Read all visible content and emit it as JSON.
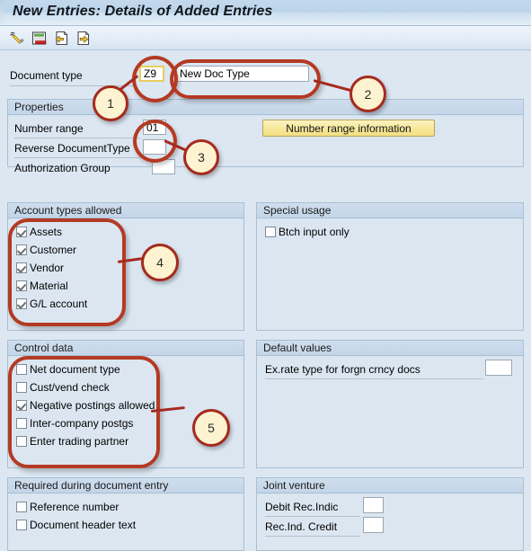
{
  "window": {
    "title": "New Entries: Details of Added Entries"
  },
  "toolbar": {
    "icons": [
      {
        "name": "check-pencil-icon",
        "title": "Check entries"
      },
      {
        "name": "save-note-icon",
        "title": "Save / Note"
      },
      {
        "name": "previous-entry-icon",
        "title": "Previous entry"
      },
      {
        "name": "next-entry-icon",
        "title": "Next entry"
      }
    ]
  },
  "header_form": {
    "document_type_label": "Document type",
    "document_type_key": "Z9",
    "document_type_key_placeholder": "",
    "document_type_text": "New Doc Type",
    "document_type_text_placeholder": ""
  },
  "properties": {
    "title": "Properties",
    "number_range_label": "Number range",
    "number_range_value": "01",
    "reverse_doc_type_label": "Reverse DocumentType",
    "reverse_doc_type_value": "",
    "authorization_group_label": "Authorization Group",
    "authorization_group_value": "",
    "number_range_button": "Number range information"
  },
  "account_types": {
    "title": "Account types allowed",
    "items": [
      {
        "label": "Assets",
        "checked": true
      },
      {
        "label": "Customer",
        "checked": true
      },
      {
        "label": "Vendor",
        "checked": true
      },
      {
        "label": "Material",
        "checked": true
      },
      {
        "label": "G/L account",
        "checked": true
      }
    ]
  },
  "special_usage": {
    "title": "Special usage",
    "items": [
      {
        "label": "Btch input only",
        "checked": false
      }
    ]
  },
  "control_data": {
    "title": "Control data",
    "items": [
      {
        "label": "Net document type",
        "checked": false
      },
      {
        "label": "Cust/vend check",
        "checked": false
      },
      {
        "label": "Negative postings allowed",
        "checked": true
      },
      {
        "label": "Inter-company postgs",
        "checked": false
      },
      {
        "label": "Enter trading partner",
        "checked": false
      }
    ]
  },
  "default_values": {
    "title": "Default values",
    "ex_rate_label": "Ex.rate type for forgn crncy docs",
    "ex_rate_value": ""
  },
  "required_entry": {
    "title": "Required during document entry",
    "items": [
      {
        "label": "Reference number",
        "checked": false
      },
      {
        "label": "Document header text",
        "checked": false
      }
    ]
  },
  "joint_venture": {
    "title": "Joint venture",
    "debit_rec_indic_label": "Debit Rec.Indic",
    "debit_rec_indic_value": "",
    "rec_ind_credit_label": "Rec.Ind. Credit",
    "rec_ind_credit_value": ""
  },
  "annotations": {
    "callouts": [
      {
        "number": "1"
      },
      {
        "number": "2"
      },
      {
        "number": "3"
      },
      {
        "number": "4"
      },
      {
        "number": "5"
      }
    ],
    "accent_color": "#a52a1f",
    "highlight_color": "#b43a23"
  }
}
